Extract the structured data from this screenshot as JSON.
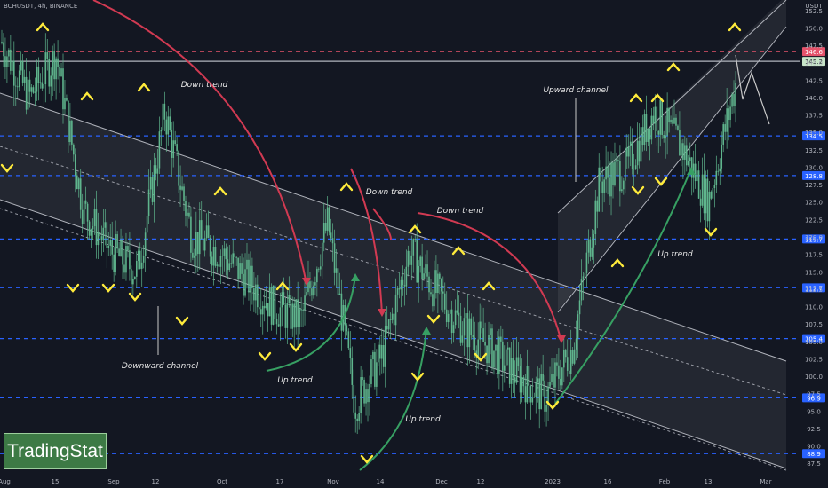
{
  "header": {
    "symbol_label": "BCHUSDT, 4h, BINANCE"
  },
  "branding": {
    "logo_text": "TradingStat"
  },
  "chart_data": {
    "type": "candlestick",
    "title": "BCHUSDT, 4h, BINANCE",
    "currency_label": "USDT",
    "y_ticks": [
      87.5,
      90.0,
      92.5,
      95.0,
      97.5,
      100.0,
      102.5,
      105.0,
      107.5,
      110.0,
      112.5,
      115.0,
      117.5,
      120.0,
      122.5,
      125.0,
      127.5,
      130.0,
      132.5,
      135.0,
      137.5,
      140.0,
      142.5,
      145.0,
      147.5,
      150.0,
      152.5
    ],
    "ylim": [
      86.0,
      154.0
    ],
    "x_ticks": [
      "Aug",
      "15",
      "Sep",
      "12",
      "Oct",
      "17",
      "Nov",
      "14",
      "Dec",
      "12",
      "2023",
      "16",
      "Feb",
      "13",
      "Mar"
    ],
    "horizontal_levels": [
      {
        "value": 146.6,
        "label": "146.6",
        "style": "dashed",
        "color": "#e5536b"
      },
      {
        "value": 145.2,
        "label": "145.2",
        "style": "solid",
        "color": "#b2b5be"
      },
      {
        "value": 134.5,
        "label": "134.5",
        "style": "dashed",
        "color": "#2962ff"
      },
      {
        "value": 128.8,
        "label": "128.8",
        "style": "dashed",
        "color": "#2962ff"
      },
      {
        "value": 119.7,
        "label": "119.7",
        "style": "dashed",
        "color": "#2962ff"
      },
      {
        "value": 112.7,
        "label": "112.7",
        "style": "dashed",
        "color": "#2962ff"
      },
      {
        "value": 105.4,
        "label": "105.4",
        "style": "dashed",
        "color": "#2962ff"
      },
      {
        "value": 96.9,
        "label": "96.9",
        "style": "dashed",
        "color": "#2962ff"
      },
      {
        "value": 88.9,
        "label": "88.9",
        "style": "dashed",
        "color": "#2962ff"
      }
    ],
    "price_path": [
      [
        "Aug",
        148.0
      ],
      [
        "Aug+",
        140.0
      ],
      [
        "15",
        146.0
      ],
      [
        "15+",
        124.0
      ],
      [
        "Sep",
        118.0
      ],
      [
        "Sep+",
        115.0
      ],
      [
        "12",
        138.0
      ],
      [
        "12+",
        120.0
      ],
      [
        "Oct",
        118.0
      ],
      [
        "Oct+",
        114.0
      ],
      [
        "17",
        110.0
      ],
      [
        "17+",
        108.0
      ],
      [
        "Nov",
        122.0
      ],
      [
        "Nov+",
        96.0
      ],
      [
        "14",
        103.0
      ],
      [
        "14+",
        118.0
      ],
      [
        "Dec",
        112.0
      ],
      [
        "Dec+",
        107.0
      ],
      [
        "12",
        104.0
      ],
      [
        "12+",
        100.0
      ],
      [
        "2023",
        97.0
      ],
      [
        "2023+",
        104.0
      ],
      [
        "16",
        128.0
      ],
      [
        "16+",
        130.0
      ],
      [
        "Feb",
        138.0
      ],
      [
        "Feb+",
        133.0
      ],
      [
        "13",
        125.0
      ],
      [
        "13+",
        142.0
      ]
    ],
    "annotations": [
      "Down trend",
      "Down trend",
      "Down trend",
      "Upward channel",
      "Downward channel",
      "Up trend",
      "Up trend",
      "Up trend"
    ],
    "colors": {
      "up": "#26a69a",
      "down": "#ef5350",
      "candle": "#5fb58d",
      "marker": "#ffeb3b",
      "arrow_red": "#d13a52",
      "arrow_green": "#37a063"
    }
  }
}
